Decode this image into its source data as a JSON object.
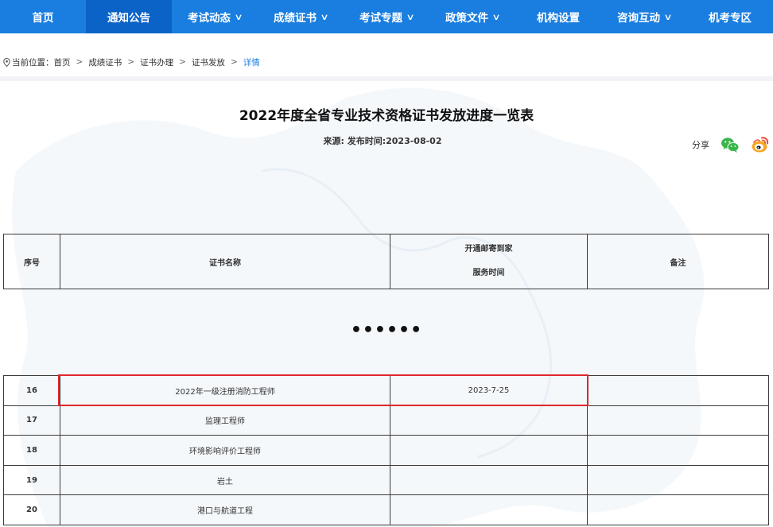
{
  "nav": {
    "items": [
      {
        "label": "首页",
        "chevron": false
      },
      {
        "label": "通知公告",
        "chevron": false
      },
      {
        "label": "考试动态",
        "chevron": true
      },
      {
        "label": "成绩证书",
        "chevron": true
      },
      {
        "label": "考试专题",
        "chevron": true
      },
      {
        "label": "政策文件",
        "chevron": true
      },
      {
        "label": "机构设置",
        "chevron": false
      },
      {
        "label": "咨询互动",
        "chevron": true
      },
      {
        "label": "机考专区",
        "chevron": false
      }
    ],
    "active_index": 1,
    "chevron_glyph": "∨"
  },
  "breadcrumb": {
    "prefix": "当前位置：",
    "separator": ">",
    "items": [
      "首页",
      "成绩证书",
      "证书办理",
      "证书发放",
      "详情"
    ]
  },
  "article": {
    "title": "2022年度全省专业技术资格证书发放进度一览表",
    "meta": "来源:  发布时间:2023-08-02"
  },
  "share": {
    "label": "分享",
    "icons": [
      "wechat-icon",
      "weibo-icon"
    ]
  },
  "table_header": {
    "col_index": "序号",
    "col_name": "证书名称",
    "col_time_line1": "开通邮寄到家",
    "col_time_line2": "服务时间",
    "col_note": "备注"
  },
  "ellipsis": "••••••",
  "table_rows": [
    {
      "index": "16",
      "name": "2022年一级注册消防工程师",
      "time": "2023-7-25",
      "note": ""
    },
    {
      "index": "17",
      "name": "监理工程师",
      "time": "",
      "note": ""
    },
    {
      "index": "18",
      "name": "环境影响评价工程师",
      "time": "",
      "note": ""
    },
    {
      "index": "19",
      "name": "岩土",
      "time": "",
      "note": ""
    },
    {
      "index": "20",
      "name": "港口与航道工程",
      "time": "",
      "note": ""
    }
  ],
  "colors": {
    "nav_bg": "#1a7ee0",
    "nav_active": "#0c63c7",
    "highlight": "#e0262b",
    "breadcrumb_current": "#1a7ee0"
  }
}
